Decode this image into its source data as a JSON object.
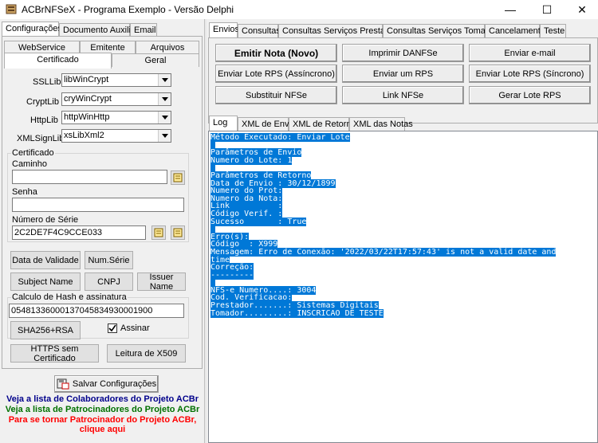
{
  "window": {
    "title": "ACBrNFSeX - Programa Exemplo - Versão Delphi",
    "minimize": "—",
    "maximize": "☐",
    "close": "✕"
  },
  "left_tabs": [
    "Configurações",
    "Documento Auxiliar",
    "Email"
  ],
  "config_tabs_row1": [
    "WebService",
    "Emitente",
    "Arquivos"
  ],
  "config_tabs_row2": [
    "Certificado",
    "Geral"
  ],
  "libs": {
    "ssllib_label": "SSLLib",
    "ssllib_value": "libWinCrypt",
    "cryptlib_label": "CryptLib",
    "cryptlib_value": "cryWinCrypt",
    "httplib_label": "HttpLib",
    "httplib_value": "httpWinHttp",
    "xmlsignlib_label": "XMLSignLib",
    "xmlsignlib_value": "xsLibXml2"
  },
  "cert": {
    "group_title": "Certificado",
    "path_label": "Caminho",
    "path_value": "",
    "password_label": "Senha",
    "password_value": "",
    "serial_label": "Número de Série",
    "serial_value": "2C2DE7F4C9CCE033"
  },
  "buttons": {
    "validity": "Data de Validade",
    "num_serie": "Num.Série",
    "subject_name": "Subject Name",
    "cnpj": "CNPJ",
    "issuer_name": "Issuer Name",
    "sha256": "SHA256+RSA",
    "https_sem_cert": "HTTPS sem Certificado",
    "x509": "Leitura de X509",
    "save": "Salvar Configurações"
  },
  "hash": {
    "group_title": "Calculo de Hash e assinatura",
    "value": "05481336000137045834930001900",
    "sign_label": "Assinar",
    "sign_checked": true
  },
  "links": {
    "colaboradores": "Veja a lista de Colaboradores do Projeto ACBr",
    "patrocinadores": "Veja a lista de Patrocinadores do Projeto ACBr",
    "tornar_line1": "Para se tornar Patrocinador do Projeto ACBr,",
    "tornar_line2": "clique aqui"
  },
  "right_tabs": [
    "Envios",
    "Consultas",
    "Consultas Serviços Prestados",
    "Consultas Serviços Tomados",
    "Cancelamento",
    "Teste"
  ],
  "action_buttons": [
    "Emitir Nota (Novo)",
    "Imprimir DANFSe",
    "Enviar e-mail",
    "Enviar Lote RPS (Assíncrono)",
    "Enviar um RPS",
    "Enviar Lote RPS (Síncrono)",
    "Substituir NFSe",
    "Link NFSe",
    "Gerar Lote RPS"
  ],
  "log_tabs": [
    "Log",
    "XML de Envio",
    "XML de Retorno",
    "XML das Notas"
  ],
  "log_lines": [
    "Método Executado: Enviar Lote",
    " ",
    "Parâmetros de Envio",
    "Numero do Lote: 1",
    " ",
    "Parâmetros de Retorno",
    "Data de Envio : 30/12/1899",
    "Numero do Prot:",
    "Numero da Nota:",
    "Link          :",
    "Código Verif. :",
    "Sucesso       : True",
    " ",
    "Erro(s):",
    "Código  : X999",
    "Mensagem: Erro de Conexão: '2022/03/22T17:57:43' is not a valid date and",
    "time",
    "Correção:",
    "---------",
    " ",
    "NFS-e Numero....: 3004",
    "Cod. Verificacao:",
    "Prestador.......: Sistemas Digitais",
    "Tomador.........: INSCRICAO DE TESTE"
  ],
  "colors": {
    "highlight": "#0078d7",
    "link_blue": "#00008b",
    "link_green": "#007000",
    "link_red": "#ff0000"
  }
}
